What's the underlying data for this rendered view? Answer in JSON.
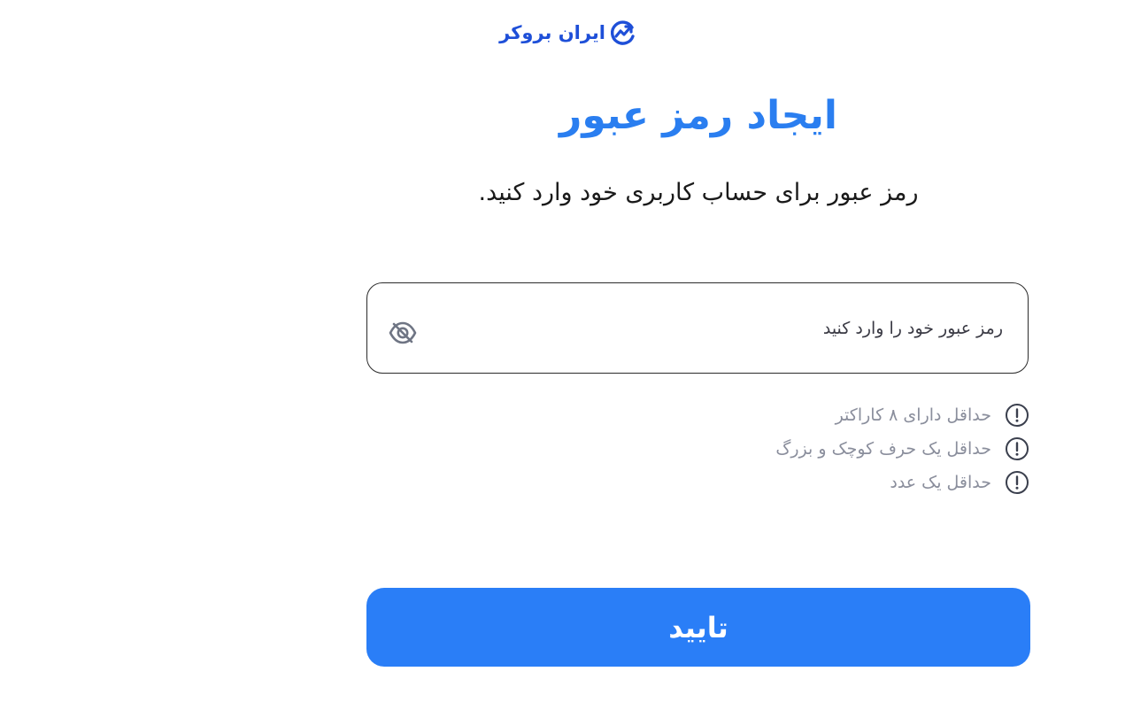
{
  "brand": {
    "name": "ایران بروکر",
    "logo_icon": "chart-trend-icon",
    "color": "#1e4fd8"
  },
  "header": {
    "title": "ایجاد رمز عبور",
    "subtitle": "رمز عبور برای حساب کاربری خود وارد کنید."
  },
  "password_field": {
    "value": "",
    "placeholder": "رمز عبور خود را وارد کنید",
    "toggle_icon": "eye-off-icon"
  },
  "requirements": [
    {
      "text": "حداقل دارای ۸ کاراکتر",
      "icon": "exclamation-circle-icon"
    },
    {
      "text": "حداقل یک حرف کوچک و بزرگ",
      "icon": "exclamation-circle-icon"
    },
    {
      "text": "حداقل یک عدد",
      "icon": "exclamation-circle-icon"
    }
  ],
  "submit": {
    "label": "تایید"
  },
  "colors": {
    "accent": "#2a7ef7",
    "title": "#2a7ef0",
    "muted": "#8a8e9c"
  }
}
